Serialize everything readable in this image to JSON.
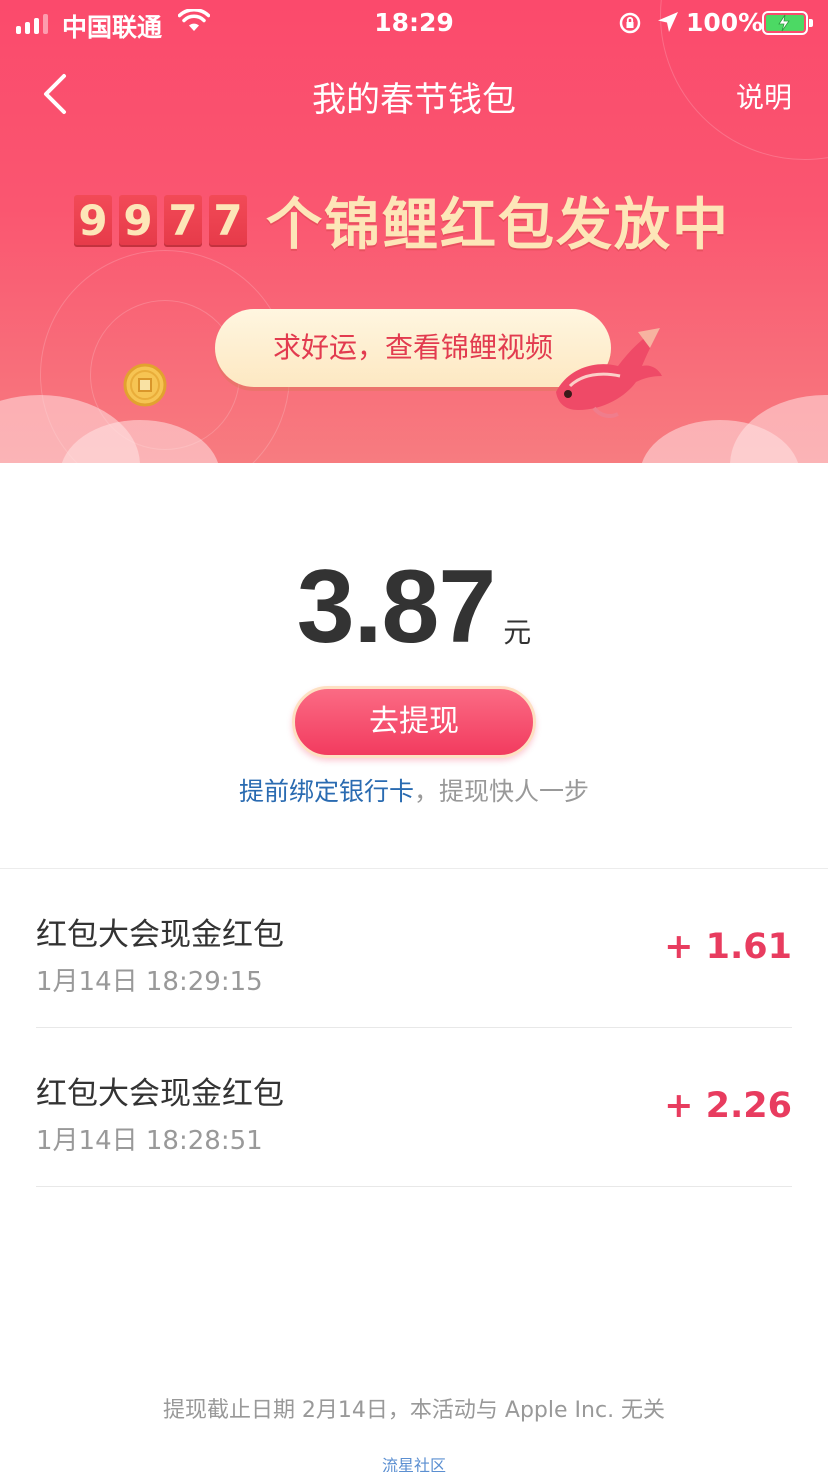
{
  "status_bar": {
    "carrier": "中国联通",
    "time": "18:29",
    "battery": "100%"
  },
  "nav": {
    "title": "我的春节钱包",
    "explain": "说明"
  },
  "banner": {
    "counter_digits": [
      "9",
      "9",
      "7",
      "7"
    ],
    "counter_text": "个锦鲤红包发放中",
    "koi_button": "求好运，查看锦鲤视频"
  },
  "balance": {
    "amount": "3.87",
    "unit": "元",
    "withdraw_button": "去提现",
    "hint_link": "提前绑定银行卡",
    "hint_text": "，提现快人一步"
  },
  "records": [
    {
      "title": "红包大会现金红包",
      "time": "1月14日 18:29:15",
      "amount": "+ 1.61"
    },
    {
      "title": "红包大会现金红包",
      "time": "1月14日 18:28:51",
      "amount": "+ 2.26"
    }
  ],
  "footer": {
    "note": "提现截止日期 2月14日，本活动与 Apple Inc. 无关",
    "watermark": "流星社区"
  },
  "colors": {
    "banner": "#fb4a6c",
    "accent": "#e83c5f",
    "link": "#2a6bb1"
  }
}
